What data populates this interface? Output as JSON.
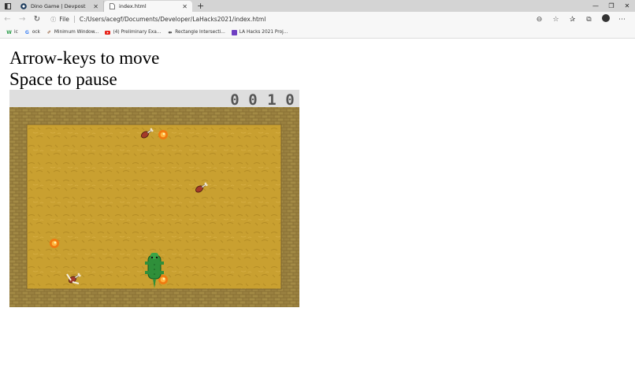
{
  "browser": {
    "tabs": [
      {
        "title": "Dino Game | Devpost",
        "active": false,
        "icon": "devpost-icon"
      },
      {
        "title": "index.html",
        "active": true,
        "icon": "file-icon"
      }
    ],
    "address": {
      "scheme_label": "File",
      "url": "C:/Users/acegf/Documents/Developer/LaHacks2021/index.html"
    },
    "bookmarks": [
      {
        "label": "ic",
        "icon": "wix-icon"
      },
      {
        "label": "ock",
        "icon": "google-icon"
      },
      {
        "label": "Minimum Window...",
        "icon": "bookmark-icon"
      },
      {
        "label": "(4) Preliminary Exa...",
        "icon": "youtube-icon"
      },
      {
        "label": "Rectangle Intersecti...",
        "icon": "link-icon"
      },
      {
        "label": "LA Hacks 2021 Proj...",
        "icon": "purple-icon"
      }
    ]
  },
  "page": {
    "line1": "Arrow-keys to move",
    "line2": "Space to pause"
  },
  "game": {
    "score_digits": [
      "0",
      "0",
      "1",
      "0"
    ],
    "colors": {
      "brick": "#8a7135",
      "brick_light": "#a38a45",
      "floor": "#c9a030",
      "hud": "#dedede",
      "dino": "#2f8f3a"
    }
  }
}
